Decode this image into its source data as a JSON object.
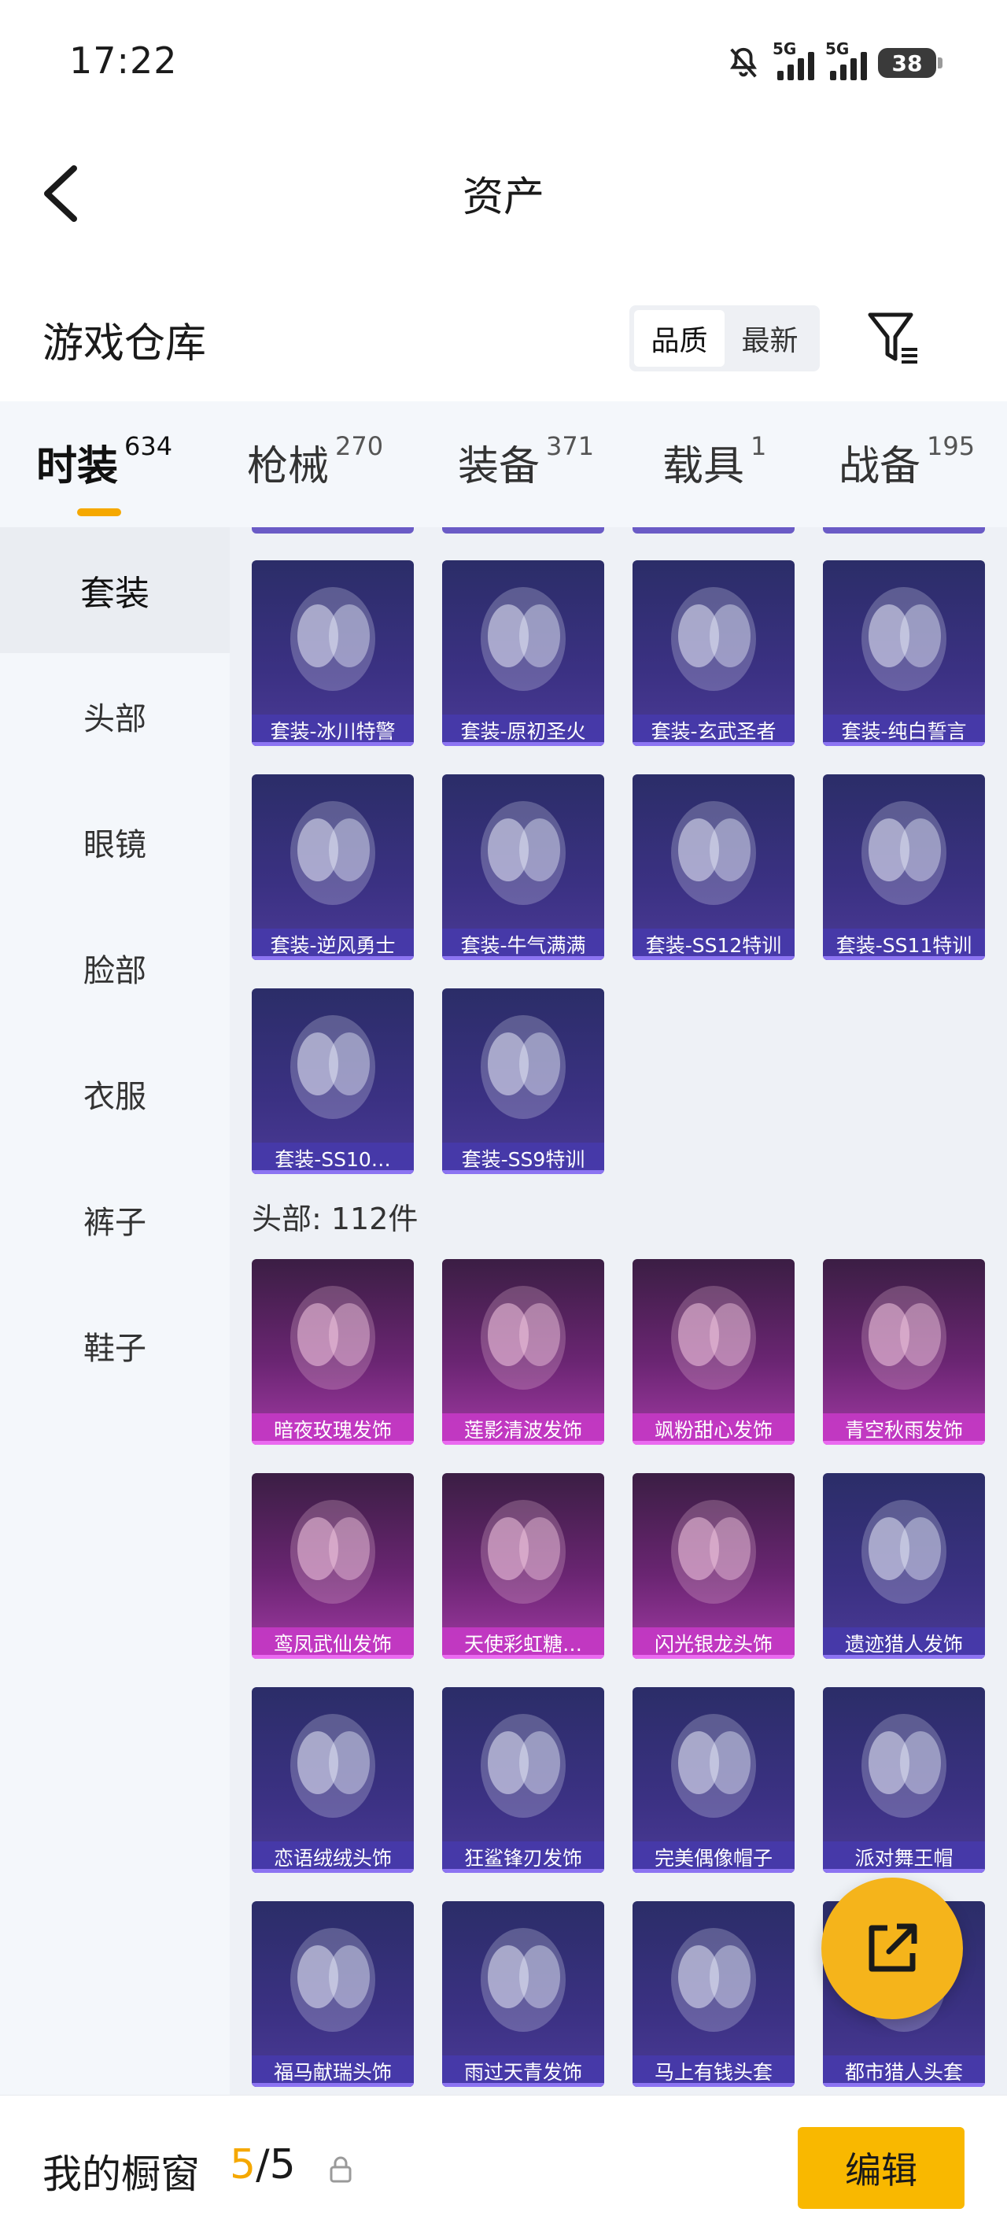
{
  "status_bar": {
    "time": "17:22",
    "network_1": "5G",
    "network_2": "5G",
    "battery": "38",
    "icons": [
      "bell-muted-icon",
      "signal-icon",
      "signal-icon",
      "battery-icon"
    ]
  },
  "nav": {
    "title": "资产",
    "back_icon": "chevron-left-icon"
  },
  "warehouse": {
    "label": "游戏仓库",
    "sort_options": [
      "品质",
      "最新"
    ],
    "sort_selected": "品质",
    "filter_icon": "filter-icon"
  },
  "tabs": [
    {
      "name": "时装",
      "count": "634"
    },
    {
      "name": "枪械",
      "count": "270"
    },
    {
      "name": "装备",
      "count": "371"
    },
    {
      "name": "载具",
      "count": "1"
    },
    {
      "name": "战备",
      "count": "195"
    }
  ],
  "active_tab": "时装",
  "accent": "#f5a800",
  "sidebar": [
    "套装",
    "头部",
    "眼镜",
    "脸部",
    "衣服",
    "裤子",
    "鞋子"
  ],
  "sidebar_active": "套装",
  "suits": [
    "套装-冰川特警",
    "套装-原初圣火",
    "套装-玄武圣者",
    "套装-纯白誓言",
    "套装-逆风勇士",
    "套装-牛气满满",
    "套装-SS12特训",
    "套装-SS11特训",
    "套装-SS10…",
    "套装-SS9特训"
  ],
  "head_section": {
    "title": "头部: 112件"
  },
  "head_items": [
    {
      "name": "暗夜玫瑰发饰",
      "rarity": "pink"
    },
    {
      "name": "莲影清波发饰",
      "rarity": "pink"
    },
    {
      "name": "飒粉甜心发饰",
      "rarity": "pink"
    },
    {
      "name": "青空秋雨发饰",
      "rarity": "pink"
    },
    {
      "name": "鸾凤武仙发饰",
      "rarity": "pink"
    },
    {
      "name": "天使彩虹糖…",
      "rarity": "pink"
    },
    {
      "name": "闪光银龙头饰",
      "rarity": "pink"
    },
    {
      "name": "遗迹猎人发饰",
      "rarity": "purple"
    },
    {
      "name": "恋语绒绒头饰",
      "rarity": "purple"
    },
    {
      "name": "狂鲨锋刃发饰",
      "rarity": "purple"
    },
    {
      "name": "完美偶像帽子",
      "rarity": "purple"
    },
    {
      "name": "派对舞王帽",
      "rarity": "purple"
    },
    {
      "name": "福马献瑞头饰",
      "rarity": "purple"
    },
    {
      "name": "雨过天青发饰",
      "rarity": "purple"
    },
    {
      "name": "马上有钱头套",
      "rarity": "purple"
    },
    {
      "name": "都市猎人头套",
      "rarity": "purple"
    }
  ],
  "share_icon": "share-external-icon",
  "bottom": {
    "label": "我的橱窗",
    "count_used": "5",
    "count_sep": "/",
    "count_total": "5",
    "lock_icon": "lock-icon",
    "edit_label": "编辑"
  }
}
